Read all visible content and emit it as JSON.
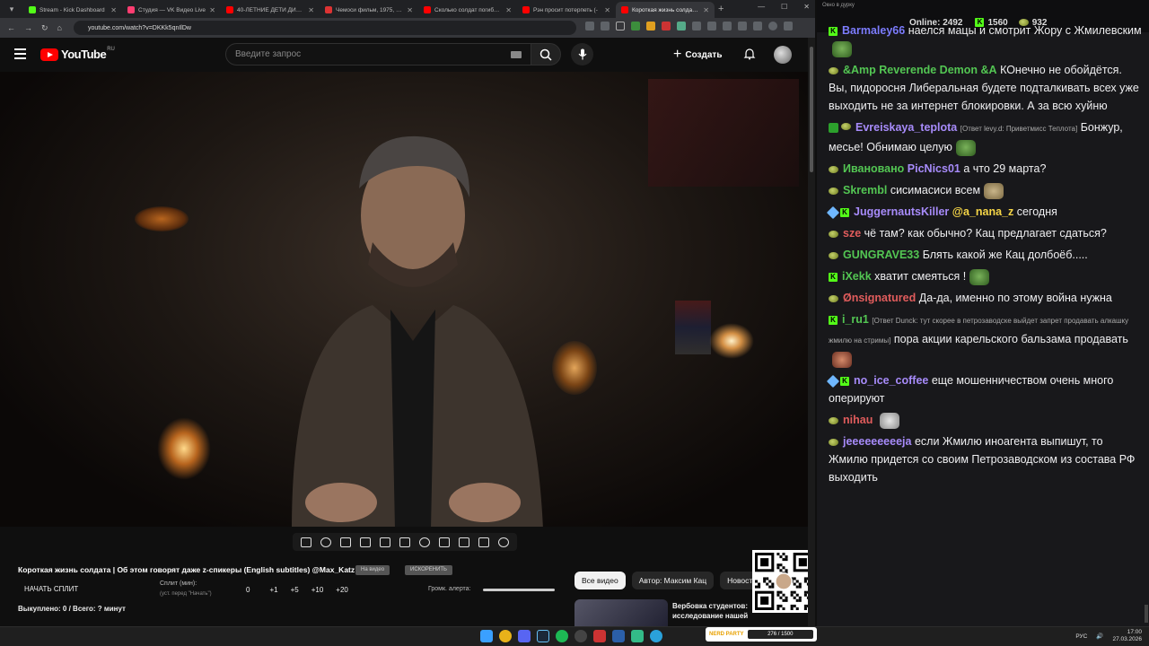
{
  "browser": {
    "tabs": [
      {
        "title": "Stream - Kick Dashboard",
        "color": "#53fc18",
        "active": false
      },
      {
        "title": "Студия — VK Видео Live",
        "color": "#ff3d71",
        "active": false
      },
      {
        "title": "40-ЛЕТНИЕ ДЕТИ ДИСНЕЯ",
        "color": "#ff0000",
        "active": false
      },
      {
        "title": "Чемоси фильм, 1975, дата",
        "color": "#d33",
        "active": false
      },
      {
        "title": "Сколько солдат погибло в",
        "color": "#ff0000",
        "active": false
      },
      {
        "title": "Рэн просит потерпеть (-",
        "color": "#ff0000",
        "active": false
      },
      {
        "title": "Короткая жизнь солдата | О",
        "color": "#ff0000",
        "active": true
      }
    ],
    "new_tab": "+",
    "url": "youtube.com/watch?v=DKKk5qnIlDw"
  },
  "youtube": {
    "logo_text": "YouTube",
    "region": "RU",
    "search_placeholder": "Введите запрос",
    "create_label": "Создать",
    "video_title": "Короткая жизнь солдата | Об этом говорят даже z-спикеры (English subtitles) @Max_Katz",
    "pill_1": "На видео",
    "pill_2": "ИСКОРЕНИТЬ",
    "split_button": "НАЧАТЬ СПЛИТ",
    "split_label": "Сплит (мин):",
    "split_sub": "(уст. перед \"Начать\")",
    "split_steps": [
      "0",
      "+1",
      "+5",
      "+10",
      "+20"
    ],
    "alert_volume_label": "Громк. алерта:",
    "bought": "Выкуплено: 0 / Всего: ? минут",
    "chips": [
      {
        "label": "Все видео",
        "active": true
      },
      {
        "label": "Автор: Максим Кац",
        "active": false
      },
      {
        "label": "Новост",
        "active": false
      }
    ],
    "rec_title": "Вербовка студентов: исследование нашей ..."
  },
  "chat": {
    "window_title": "Окно в дурку",
    "online_label": "Online:",
    "online": "2492",
    "kick_count": "1560",
    "pea_count": "932",
    "messages": [
      {
        "user": "Barmaley66",
        "color": "#7d7dff",
        "text": "наелся мацы и смотрит Жору с Жмилевским",
        "reply": "",
        "emote": "e-frog",
        "badges": [
          "kick"
        ]
      },
      {
        "user": "&Amp Reverende Demon &A",
        "color": "#53c653",
        "text": "КОнечно не обойдётся. Вы, пидоросня Либеральная будете подталкивать всех уже выходить не за интернет блокировки. А за всю хуйню",
        "reply": "",
        "emote": "",
        "badges": [
          "pea"
        ]
      },
      {
        "user": "Evreiskaya_teplota",
        "color": "#a78bfa",
        "text": "Бонжур, месье! Обнимаю целую",
        "reply": "[Ответ levy.d: Приветмисс Теплота]",
        "emote": "e-frog",
        "badges": [
          "chk",
          "pea"
        ]
      },
      {
        "user": "Ивановано",
        "color": "#53c653",
        "text": "а что 29 марта?",
        "reply": "",
        "emote": "",
        "mention": "PicNics01",
        "badges": [
          "pea"
        ]
      },
      {
        "user": "Skrembl",
        "color": "#53c653",
        "text": "сисимасиси всем",
        "reply": "",
        "emote": "e-bread",
        "badges": [
          "pea"
        ]
      },
      {
        "user": "JuggernautsKiller",
        "color": "#a78bfa",
        "text": "сегодня",
        "reply": "",
        "emote": "",
        "mention": "@a_nana_z",
        "badges": [
          "sw",
          "kick"
        ]
      },
      {
        "user": "sze",
        "color": "#e05c5c",
        "text": "чё там? как обычно? Кац предлагает сдаться?",
        "reply": "",
        "emote": "",
        "badges": [
          "pea"
        ]
      },
      {
        "user": "GUNGRAVE33",
        "color": "#53c653",
        "text": "Блять какой же Кац долбоёб.....",
        "reply": "",
        "emote": "",
        "badges": [
          "pea"
        ]
      },
      {
        "user": "iXekk",
        "color": "#53c653",
        "text": "хватит смеяться !",
        "reply": "",
        "emote": "e-frog",
        "badges": [
          "kick"
        ]
      },
      {
        "user": "Ønsignatured",
        "color": "#e05c5c",
        "text": "Да-да, именно по этому война нужна",
        "reply": "",
        "emote": "",
        "badges": [
          "pea"
        ]
      },
      {
        "user": "i_ru1",
        "color": "#53c653",
        "text": "пора акции карельского бальзама продавать",
        "reply": "[Ответ Dunck: тут скорее в петрозаводске выйдет запрет продавать алкашку жмилю на стримы]",
        "emote": "e-face",
        "badges": [
          "kick"
        ]
      },
      {
        "user": "no_ice_coffee",
        "color": "#a78bfa",
        "text": "еще мошенничеством очень много оперируют",
        "reply": "",
        "emote": "",
        "badges": [
          "sw",
          "kick"
        ]
      },
      {
        "user": "nihau",
        "color": "#e05c5c",
        "text": "",
        "reply": "",
        "emote": "e-goat",
        "badges": [
          "pea"
        ]
      },
      {
        "user": "jeeeeeeeeeja",
        "color": "#a78bfa",
        "text": "если Жмилю иноагента выпишут, то Жмилю придется со своим Петрозаводском из состава РФ выходить",
        "reply": "",
        "emote": "",
        "badges": [
          "pea"
        ]
      }
    ]
  },
  "taskbar": {
    "nerd_label": "NERD PARTY",
    "nerd_progress": "276 / 1500",
    "lang": "РУС",
    "time": "17:00",
    "date": "27.03.2026"
  }
}
